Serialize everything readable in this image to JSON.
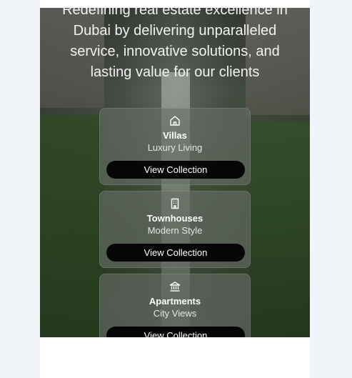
{
  "hero": {
    "tagline": "Redefining real estate excellence in Dubai by delivering unparalleled service, innovative solutions, and lasting value for our clients"
  },
  "collections": [
    {
      "icon": "home-icon",
      "title": "Villas",
      "subtitle": "Luxury Living",
      "button_label": "View Collection"
    },
    {
      "icon": "building-icon",
      "title": "Townhouses",
      "subtitle": "Modern Style",
      "button_label": "View Collection"
    },
    {
      "icon": "bank-icon",
      "title": "Apartments",
      "subtitle": "City Views",
      "button_label": "View Collection"
    }
  ],
  "colors": {
    "button_bg": "#060606",
    "card_bg": "rgba(105,110,105,0.62)",
    "page_bg": "#f1f4f9"
  }
}
